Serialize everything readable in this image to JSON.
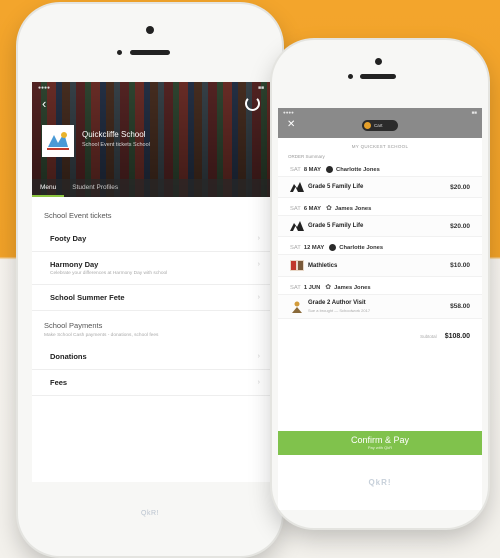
{
  "left": {
    "school_name": "Quickcliffe School",
    "school_subtitle": "School Event tickets School",
    "tabs": [
      {
        "label": "Menu",
        "active": true
      },
      {
        "label": "Student Profiles",
        "active": false
      }
    ],
    "sections": [
      {
        "title": "School Event tickets",
        "description": "",
        "items": [
          {
            "title": "Footy Day",
            "subtitle": ""
          },
          {
            "title": "Harmony Day",
            "subtitle": "Celebrate your differences at Harmony Day with school"
          },
          {
            "title": "School Summer Fete",
            "subtitle": ""
          }
        ]
      },
      {
        "title": "School Payments",
        "description": "Make School Cash payments - donations, school fees",
        "items": [
          {
            "title": "Donations",
            "subtitle": ""
          },
          {
            "title": "Fees",
            "subtitle": ""
          }
        ]
      }
    ],
    "home_label": "QkR!"
  },
  "right": {
    "pill_label": "Cart",
    "school_header": "MY QUICKEST SCHOOL",
    "orders_label": "ORDER Summary",
    "orders": [
      {
        "day": "SAT",
        "date": "8 MAY",
        "avatar": "dark",
        "person": "Charlotte Jones",
        "item": {
          "icon": "mountain",
          "name": "Grade 5 Family Life",
          "sub": "",
          "price": "$20.00"
        }
      },
      {
        "day": "SAT",
        "date": "6 MAY",
        "avatar": "star",
        "person": "James Jones",
        "item": {
          "icon": "mountain",
          "name": "Grade 5 Family Life",
          "sub": "",
          "price": "$20.00"
        }
      },
      {
        "day": "SAT",
        "date": "12 MAY",
        "avatar": "dark",
        "person": "Charlotte Jones",
        "item": {
          "icon": "book",
          "name": "Mathletics",
          "sub": "",
          "price": "$10.00"
        }
      },
      {
        "day": "SAT",
        "date": "1 JUN",
        "avatar": "star",
        "person": "James Jones",
        "item": {
          "icon": "author",
          "name": "Grade 2 Author Visit",
          "sub": "Sue a brought — Schoolwork 2017",
          "price": "$58.00"
        }
      }
    ],
    "total_label": "Subtotal",
    "total_value": "$108.00",
    "confirm_label": "Confirm & Pay",
    "confirm_sub": "Pay with QkR",
    "home_label": "QkR!"
  },
  "colors": {
    "background": "#f3a52c",
    "accent": "#80c24c"
  }
}
